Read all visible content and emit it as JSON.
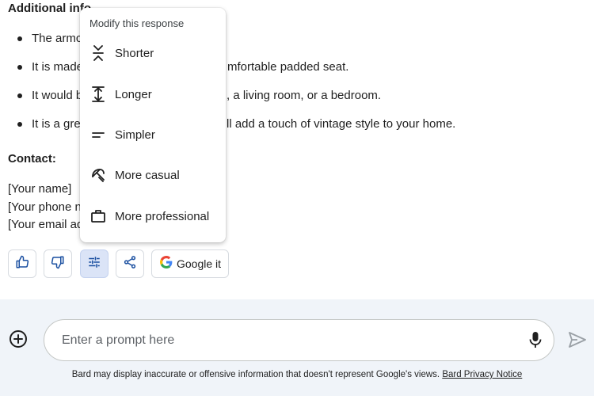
{
  "response": {
    "heading": "Additional info",
    "bullets": [
      {
        "left": "The armc",
        "right": ""
      },
      {
        "left": "It is made",
        "right": "mfortable padded seat."
      },
      {
        "left": "It would b",
        "right": ", a living room, or a bedroom."
      },
      {
        "left": "It is a grea",
        "right": "ll add a touch of vintage style to your home."
      }
    ],
    "contact_title": "Contact:",
    "contact_lines": [
      "[Your name]",
      "[Your phone n",
      "[Your email ad"
    ]
  },
  "modify_menu": {
    "title": "Modify this response",
    "items": [
      {
        "label": "Shorter",
        "icon": "shorter-icon"
      },
      {
        "label": "Longer",
        "icon": "longer-icon"
      },
      {
        "label": "Simpler",
        "icon": "simpler-icon"
      },
      {
        "label": "More casual",
        "icon": "casual-icon"
      },
      {
        "label": "More professional",
        "icon": "briefcase-icon"
      }
    ]
  },
  "actions": {
    "google_it_label": "Google it",
    "buttons": [
      "thumbs-up-icon",
      "thumbs-down-icon",
      "tune-icon",
      "share-icon"
    ]
  },
  "prompt": {
    "placeholder": "Enter a prompt here",
    "value": ""
  },
  "footer": {
    "disclaimer": "Bard may display inaccurate or offensive information that doesn't represent Google's views.",
    "privacy_link": "Bard Privacy Notice"
  },
  "colors": {
    "active_button_bg": "#dbe4f7",
    "bottom_bg": "#f0f4f9",
    "google_blue": "#4285f4"
  }
}
